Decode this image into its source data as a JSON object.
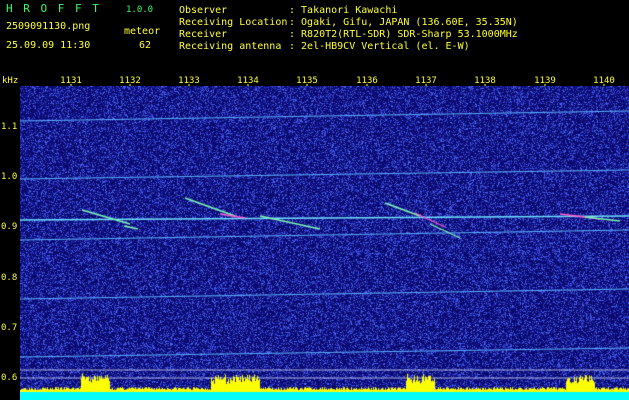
{
  "header": {
    "brand": "H R O F F T",
    "version": "1.0.0",
    "filename": "2509091130.png",
    "mode": "meteor",
    "datetime": "25.09.09 11:30",
    "count": "62",
    "fields": [
      {
        "label": "Observer",
        "value": ": Takanori Kawachi"
      },
      {
        "label": "Receiving Location",
        "value": ": Ogaki, Gifu, JAPAN (136.60E, 35.35N)"
      },
      {
        "label": "Receiver",
        "value": ": R820T2(RTL-SDR) SDR-Sharp 53.1000MHz"
      },
      {
        "label": "Receiving antenna",
        "value": ": 2el-HB9CV Vertical (el. E-W)"
      }
    ]
  },
  "axis": {
    "unit": "kHz",
    "x_ticks": [
      "1131",
      "1132",
      "1133",
      "1134",
      "1135",
      "1136",
      "1137",
      "1138",
      "1139",
      "1140"
    ],
    "y_ticks": [
      "1.1",
      "1.0",
      "0.9",
      "0.8",
      "0.7",
      "0.6"
    ]
  },
  "colors": {
    "background": "#000000",
    "spectrogram_bg": "#0a0a6e",
    "header_text": "#ffff33",
    "header_green": "#33ff66",
    "tick_text": "#ffff33",
    "carrier_line": "#5ab0ff",
    "power_trace": "#ffff00",
    "baseline": "#00ffff"
  }
}
